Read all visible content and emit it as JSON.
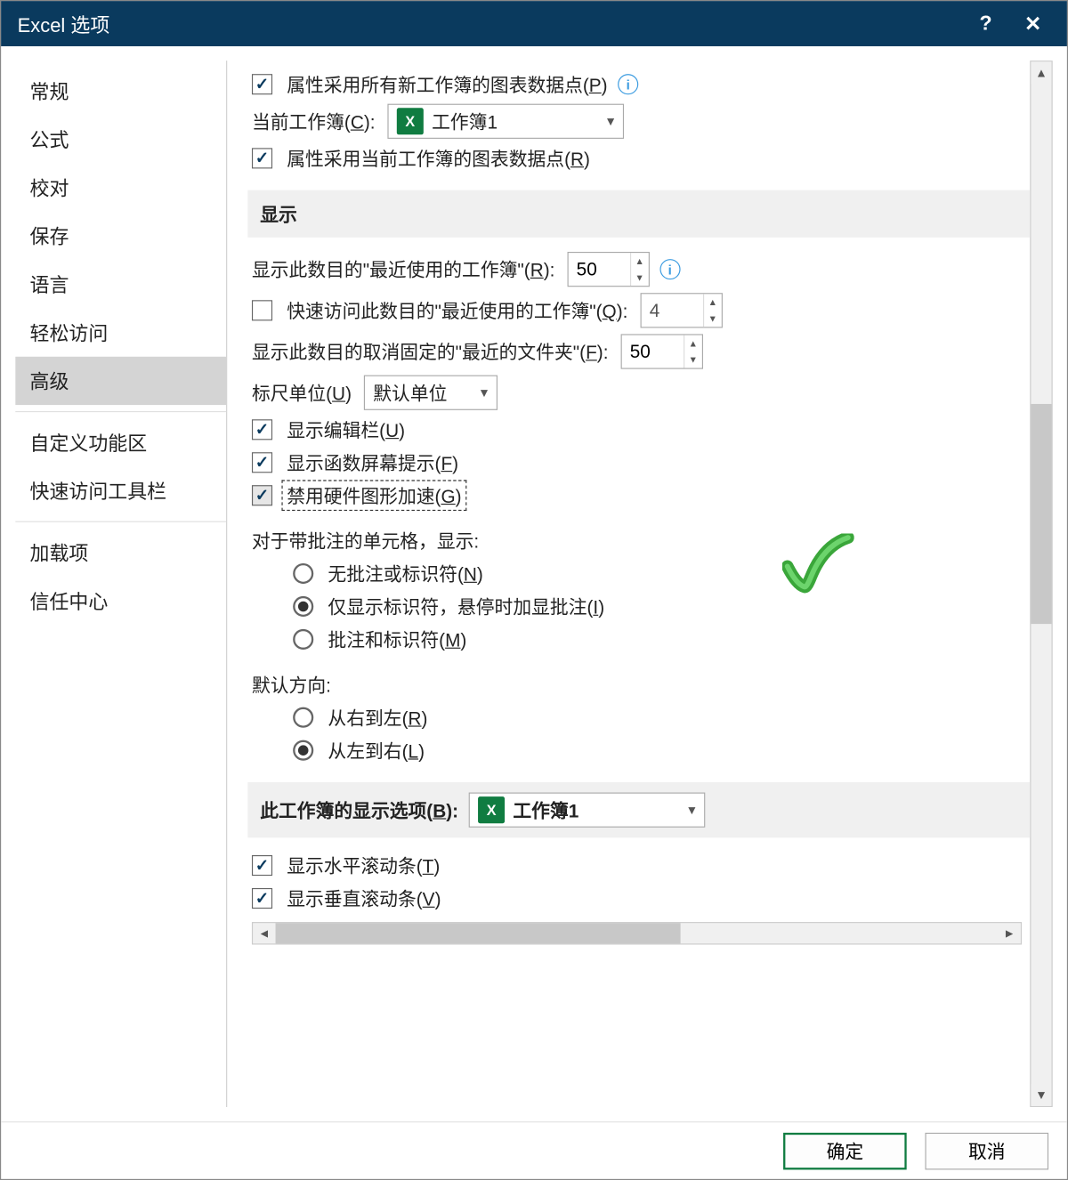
{
  "window": {
    "title": "Excel 选项",
    "help": "?",
    "close": "✕"
  },
  "sidebar": {
    "items": [
      "常规",
      "公式",
      "校对",
      "保存",
      "语言",
      "轻松访问",
      "高级",
      "自定义功能区",
      "快速访问工具栏",
      "加载项",
      "信任中心"
    ],
    "selected_index": 6
  },
  "top": {
    "chk_all_new": {
      "text": "属性采用所有新工作簿的图表数据点(",
      "accel": "P",
      "suffix": ")"
    },
    "current_wb_label": "当前工作簿(",
    "current_wb_accel": "C",
    "current_wb_suffix": "):",
    "current_wb_value": "工作簿1",
    "chk_current": {
      "text": "属性采用当前工作簿的图表数据点(",
      "accel": "R",
      "suffix": ")"
    }
  },
  "display": {
    "header": "显示",
    "recent_label": "显示此数目的\"最近使用的工作簿\"(",
    "recent_accel": "R",
    "recent_suffix": "):",
    "recent_value": "50",
    "quick_label": "快速访问此数目的\"最近使用的工作簿\"(",
    "quick_accel": "Q",
    "quick_suffix": "):",
    "quick_value": "4",
    "unpinned_label": "显示此数目的取消固定的\"最近的文件夹\"(",
    "unpinned_accel": "F",
    "unpinned_suffix": "):",
    "unpinned_value": "50",
    "ruler_label": "标尺单位(",
    "ruler_accel": "U",
    "ruler_suffix": ")",
    "ruler_value": "默认单位",
    "chk_formula_bar": {
      "text": "显示编辑栏(",
      "accel": "U",
      "suffix": ")"
    },
    "chk_func_tips": {
      "text": "显示函数屏幕提示(",
      "accel": "F",
      "suffix": ")"
    },
    "chk_hw_accel": {
      "text": "禁用硬件图形加速(",
      "accel": "G",
      "suffix": ")"
    },
    "comments_header": "对于带批注的单元格，显示:",
    "radio_none": {
      "text": "无批注或标识符(",
      "accel": "N",
      "suffix": ")"
    },
    "radio_ind": {
      "text": "仅显示标识符，悬停时加显批注(",
      "accel": "I",
      "suffix": ")"
    },
    "radio_both": {
      "text": "批注和标识符(",
      "accel": "M",
      "suffix": ")"
    },
    "dir_header": "默认方向:",
    "radio_rtl": {
      "text": "从右到左(",
      "accel": "R",
      "suffix": ")"
    },
    "radio_ltr": {
      "text": "从左到右(",
      "accel": "L",
      "suffix": ")"
    }
  },
  "wb_display": {
    "header_text": "此工作簿的显示选项(",
    "header_accel": "B",
    "header_suffix": "):",
    "value": "工作簿1",
    "chk_hscroll": {
      "text": "显示水平滚动条(",
      "accel": "T",
      "suffix": ")"
    },
    "chk_vscroll": {
      "text": "显示垂直滚动条(",
      "accel": "V",
      "suffix": ")"
    }
  },
  "footer": {
    "ok": "确定",
    "cancel": "取消"
  }
}
